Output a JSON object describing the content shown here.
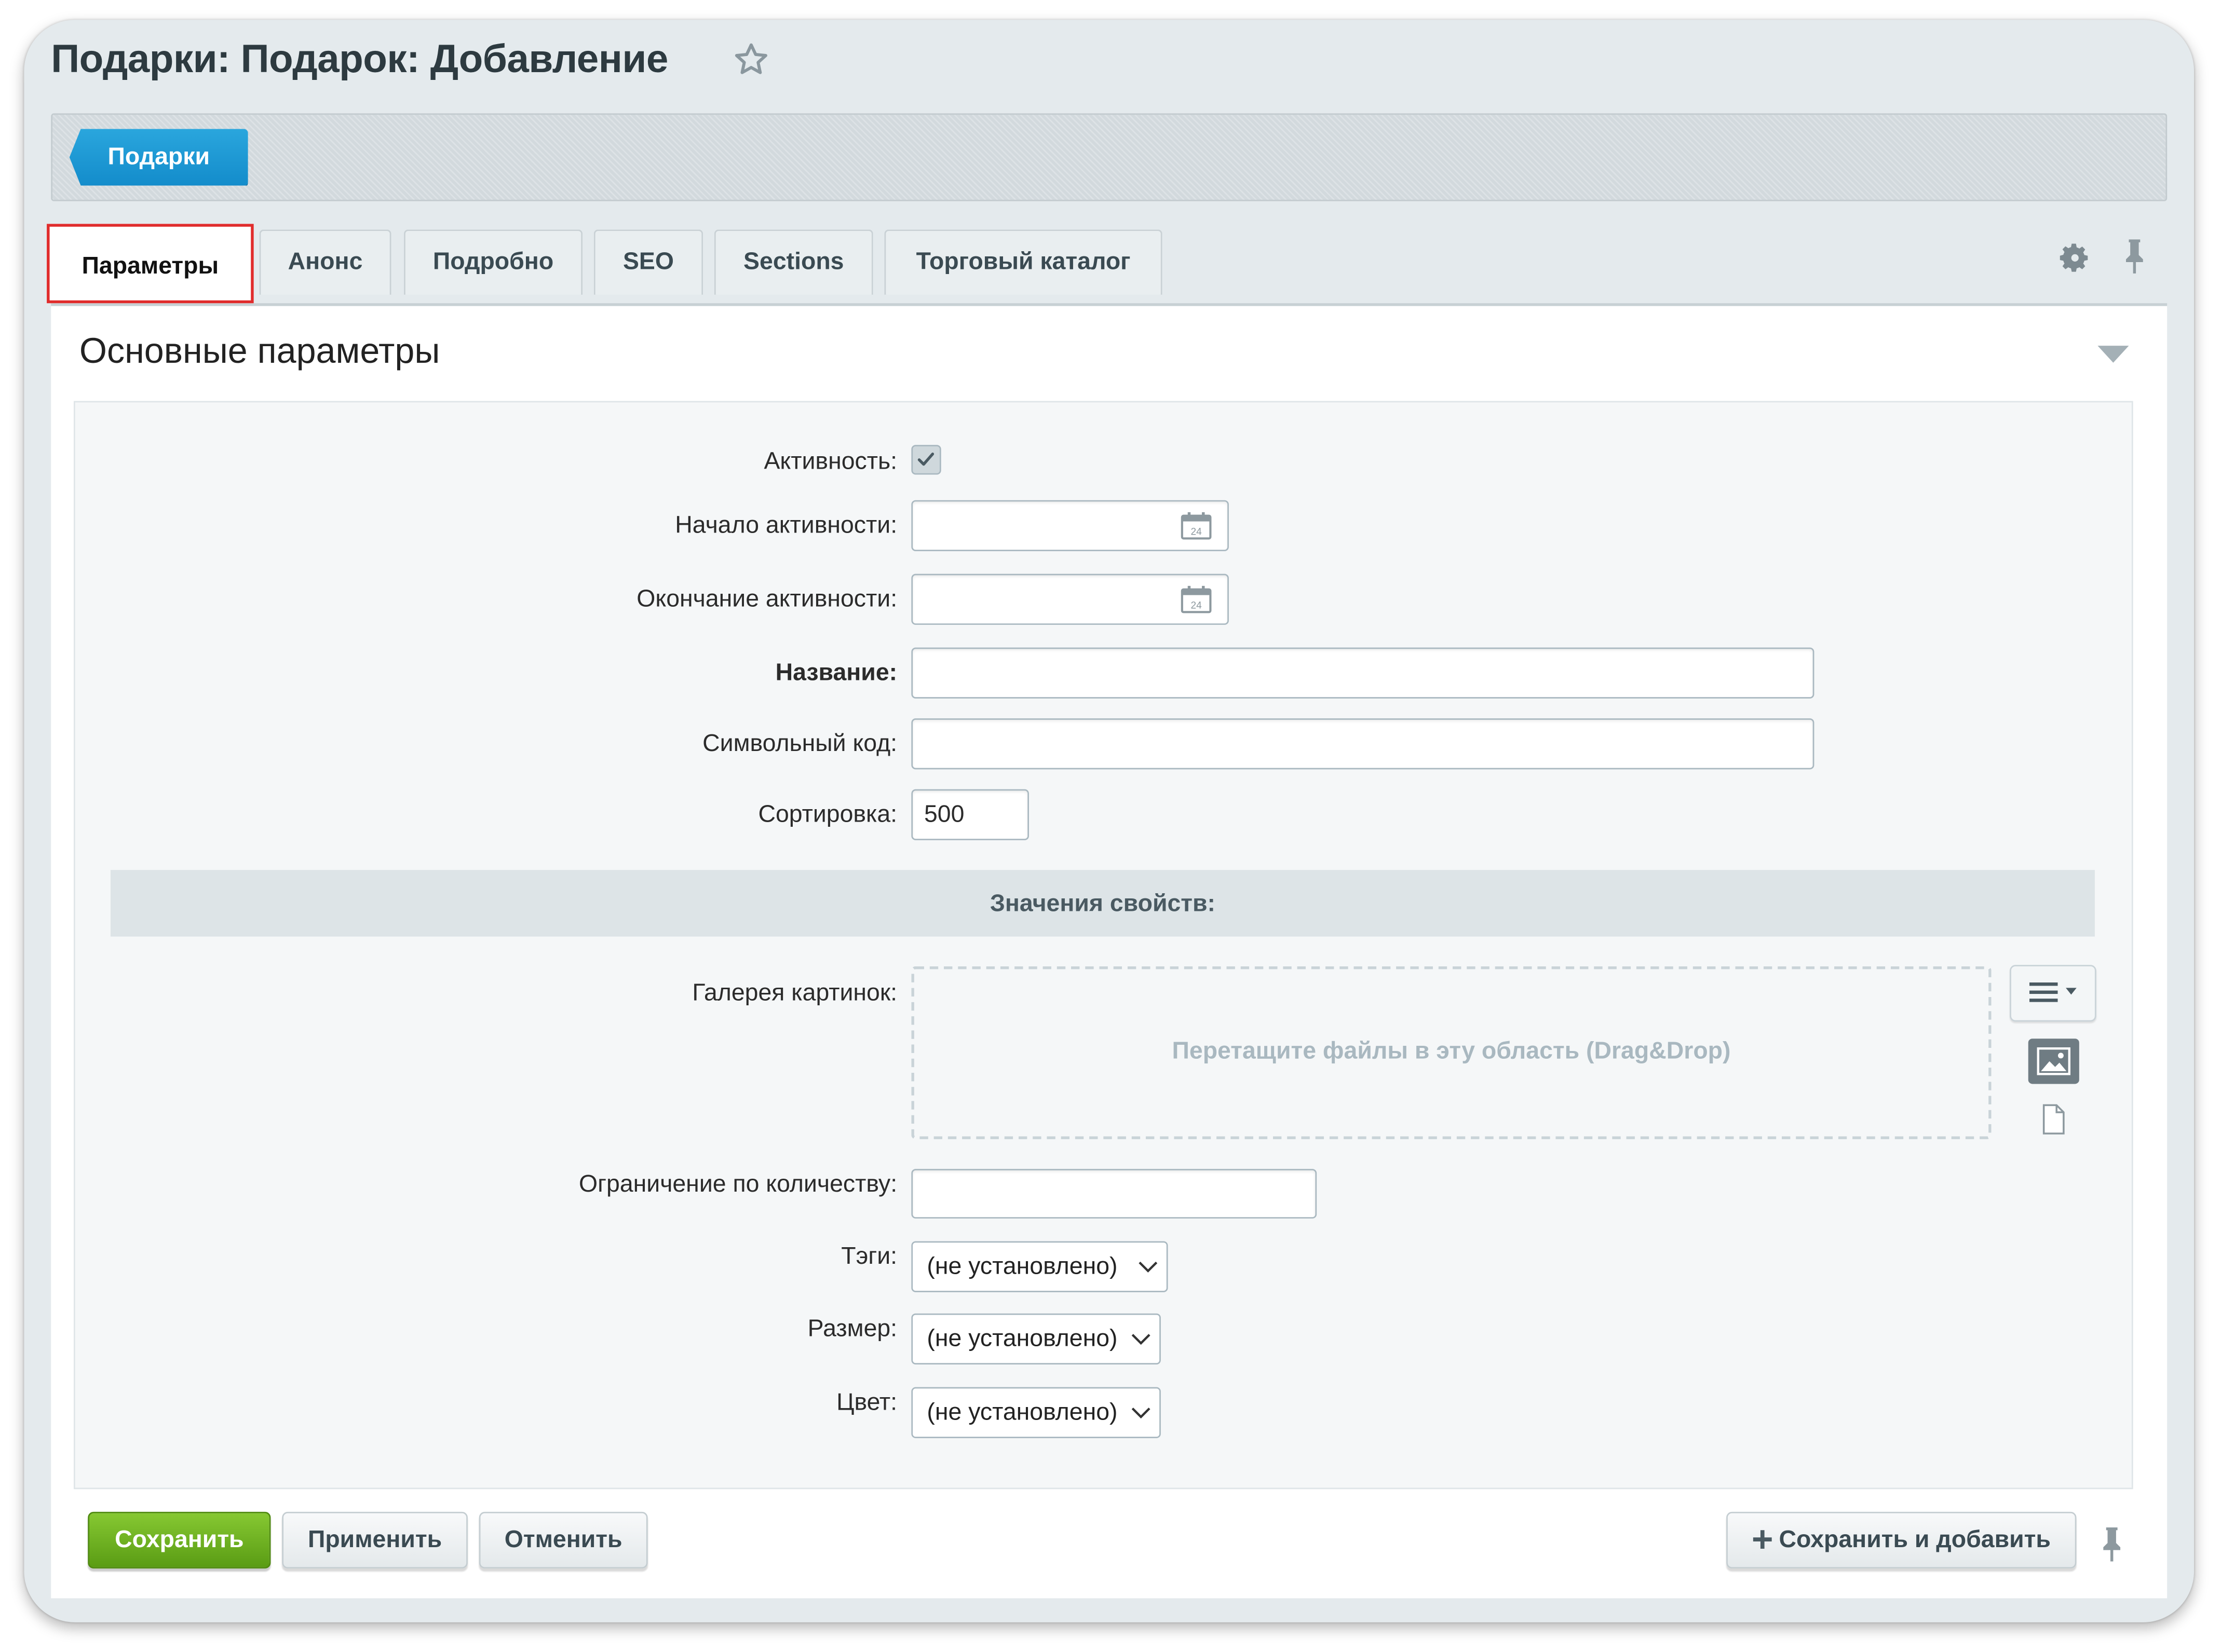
{
  "header": {
    "title": "Подарки: Подарок: Добавление",
    "favorite_icon": "star-icon"
  },
  "breadcrumb": {
    "label": "Подарки"
  },
  "tabs": [
    {
      "label": "Параметры",
      "active": true
    },
    {
      "label": "Анонс"
    },
    {
      "label": "Подробно"
    },
    {
      "label": "SEO"
    },
    {
      "label": "Sections"
    },
    {
      "label": "Торговый каталог"
    }
  ],
  "section": {
    "title": "Основные параметры"
  },
  "fields": {
    "active": {
      "label": "Активность:",
      "checked": true
    },
    "active_from": {
      "label": "Начало активности:",
      "value": ""
    },
    "active_to": {
      "label": "Окончание активности:",
      "value": ""
    },
    "name": {
      "label": "Название:",
      "value": ""
    },
    "code": {
      "label": "Символьный код:",
      "value": ""
    },
    "sort": {
      "label": "Сортировка:",
      "value": "500"
    }
  },
  "properties": {
    "title": "Значения свойств:",
    "gallery": {
      "label": "Галерея картинок:",
      "dropzone_text": "Перетащите файлы в эту область (Drag&Drop)"
    },
    "limit": {
      "label": "Ограничение по количеству:",
      "value": ""
    },
    "tags": {
      "label": "Тэги:",
      "value": "(не установлено)"
    },
    "size": {
      "label": "Размер:",
      "value": "(не установлено)"
    },
    "color": {
      "label": "Цвет:",
      "value": "(не установлено)"
    }
  },
  "footer": {
    "save": "Сохранить",
    "apply": "Применить",
    "cancel": "Отменить",
    "save_and_add": "Сохранить и добавить"
  },
  "colors": {
    "accent_blue": "#1a97d5",
    "save_green": "#6cb222",
    "highlight_red": "#e02c2c"
  }
}
